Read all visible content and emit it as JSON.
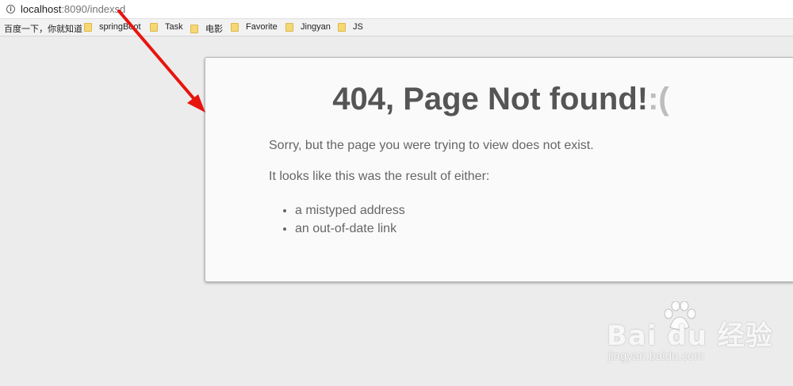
{
  "browser": {
    "url_host": "localhost",
    "url_rest": ":8090/indexsd",
    "info_icon": "info-icon"
  },
  "bookmarks": [
    {
      "label": "百度一下，你就知道",
      "icon": "none"
    },
    {
      "label": "springBoot",
      "icon": "folder-icon"
    },
    {
      "label": "Task",
      "icon": "folder-icon"
    },
    {
      "label": "电影",
      "icon": "folder-icon"
    },
    {
      "label": "Favorite",
      "icon": "folder-icon"
    },
    {
      "label": "Jingyan",
      "icon": "folder-icon"
    },
    {
      "label": "JS",
      "icon": "folder-icon"
    }
  ],
  "page": {
    "heading": "404, Page Not found!",
    "heading_emoticon": ":(",
    "sorry_text": "Sorry, but the page you were trying to view does not exist.",
    "result_text": "It looks like this was the result of either:",
    "reasons": [
      "a mistyped address",
      "an out-of-date link"
    ]
  },
  "annotation": {
    "arrow_color": "#e8140e"
  },
  "watermark": {
    "logo_text": "Bai du 经验",
    "url_text": "jingyan.baidu.com"
  },
  "colors": {
    "background": "#ececec",
    "card": "#fafafa",
    "heading": "#555555",
    "body_text": "#666666"
  }
}
